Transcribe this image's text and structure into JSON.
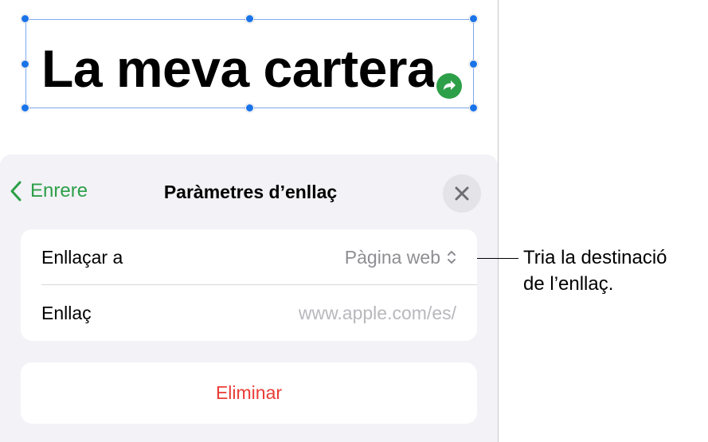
{
  "canvas_title": "La meva cartera",
  "sheet": {
    "back_label": "Enrere",
    "title": "Paràmetres d’enllaç",
    "rows": [
      {
        "label": "Enllaçar a",
        "value": "Pàgina web"
      },
      {
        "label": "Enllaç",
        "value": "www.apple.com/es/"
      }
    ],
    "delete_label": "Eliminar"
  },
  "callout": {
    "line1": "Tria la destinació",
    "line2": "de l’enllaç."
  },
  "colors": {
    "accent_green": "#2d9f48",
    "selection_blue": "#1a73e8",
    "destructive_red": "#ea3d36",
    "sheet_background": "#f2f2f7"
  },
  "icons": {
    "back": "chevron-left-icon",
    "close": "close-icon",
    "link_badge": "link-arrow-icon",
    "stepper": "up-down-chevron-icon"
  }
}
